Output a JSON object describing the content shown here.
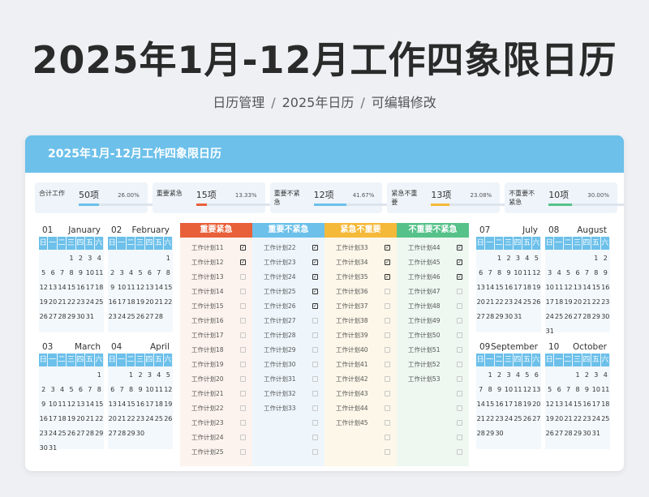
{
  "title": "2025年1月-12月工作四象限日历",
  "breadcrumb": [
    "日历管理",
    "2025年日历",
    "可编辑修改"
  ],
  "card_title": "2025年1月-12月工作四象限日历",
  "stats": [
    {
      "label": "合计工作",
      "count": "50项",
      "pct": "26.00%",
      "level": 0.26,
      "color": "#6cc0ea"
    },
    {
      "label": "重要紧急",
      "count": "15项",
      "pct": "13.33%",
      "level": 0.1333,
      "color": "#e8603a"
    },
    {
      "label": "重要不紧急",
      "count": "12项",
      "pct": "41.67%",
      "level": 0.4167,
      "color": "#6cc0ea"
    },
    {
      "label": "紧急不重要",
      "count": "13项",
      "pct": "23.08%",
      "level": 0.2308,
      "color": "#f5b93a"
    },
    {
      "label": "不重要不紧急",
      "count": "10项",
      "pct": "30.00%",
      "level": 0.3,
      "color": "#56c28a"
    }
  ],
  "weekdays": [
    "日",
    "一",
    "二",
    "三",
    "四",
    "五",
    "六"
  ],
  "months": [
    {
      "num": "01",
      "name": "January",
      "days": [
        "",
        "",
        "",
        "1",
        "2",
        "3",
        "4",
        "5",
        "6",
        "7",
        "8",
        "9",
        "10",
        "11",
        "12",
        "13",
        "14",
        "15",
        "16",
        "17",
        "18",
        "19",
        "20",
        "21",
        "22",
        "23",
        "24",
        "25",
        "26",
        "27",
        "28",
        "29",
        "30",
        "31"
      ]
    },
    {
      "num": "02",
      "name": "February",
      "days": [
        "",
        "",
        "",
        "",
        "",
        "",
        "1",
        "2",
        "3",
        "4",
        "5",
        "6",
        "7",
        "8",
        "9",
        "10",
        "11",
        "12",
        "13",
        "14",
        "15",
        "16",
        "17",
        "18",
        "19",
        "20",
        "21",
        "22",
        "23",
        "24",
        "25",
        "26",
        "27",
        "28"
      ]
    },
    {
      "num": "03",
      "name": "March",
      "days": [
        "",
        "",
        "",
        "",
        "",
        "",
        "1",
        "2",
        "3",
        "4",
        "5",
        "6",
        "7",
        "8",
        "9",
        "10",
        "11",
        "12",
        "13",
        "14",
        "15",
        "16",
        "17",
        "18",
        "19",
        "20",
        "21",
        "22",
        "23",
        "24",
        "25",
        "26",
        "27",
        "28",
        "29",
        "30",
        "31"
      ]
    },
    {
      "num": "04",
      "name": "April",
      "days": [
        "",
        "",
        "1",
        "2",
        "3",
        "4",
        "5",
        "6",
        "7",
        "8",
        "9",
        "10",
        "11",
        "12",
        "13",
        "14",
        "15",
        "16",
        "17",
        "18",
        "19",
        "20",
        "21",
        "22",
        "23",
        "24",
        "25",
        "26",
        "27",
        "28",
        "29",
        "30"
      ]
    },
    {
      "num": "07",
      "name": "July",
      "days": [
        "",
        "",
        "1",
        "2",
        "3",
        "4",
        "5",
        "6",
        "7",
        "8",
        "9",
        "10",
        "11",
        "12",
        "13",
        "14",
        "15",
        "16",
        "17",
        "18",
        "19",
        "20",
        "21",
        "22",
        "23",
        "24",
        "25",
        "26",
        "27",
        "28",
        "29",
        "30",
        "31"
      ]
    },
    {
      "num": "08",
      "name": "August",
      "days": [
        "",
        "",
        "",
        "",
        "",
        "1",
        "2",
        "3",
        "4",
        "5",
        "6",
        "7",
        "8",
        "9",
        "10",
        "11",
        "12",
        "13",
        "14",
        "15",
        "16",
        "17",
        "18",
        "19",
        "20",
        "21",
        "22",
        "23",
        "24",
        "25",
        "26",
        "27",
        "28",
        "29",
        "30",
        "31"
      ]
    },
    {
      "num": "09",
      "name": "September",
      "days": [
        "",
        "1",
        "2",
        "3",
        "4",
        "5",
        "6",
        "7",
        "8",
        "9",
        "10",
        "11",
        "12",
        "13",
        "14",
        "15",
        "16",
        "17",
        "18",
        "19",
        "20",
        "21",
        "22",
        "23",
        "24",
        "25",
        "26",
        "27",
        "28",
        "29",
        "30"
      ]
    },
    {
      "num": "10",
      "name": "October",
      "days": [
        "",
        "",
        "",
        "1",
        "2",
        "3",
        "4",
        "5",
        "6",
        "7",
        "8",
        "9",
        "10",
        "11",
        "12",
        "13",
        "14",
        "15",
        "16",
        "17",
        "18",
        "19",
        "20",
        "21",
        "22",
        "23",
        "24",
        "25",
        "26",
        "27",
        "28",
        "29",
        "30",
        "31"
      ]
    }
  ],
  "quadrants": [
    {
      "title": "重要紧急",
      "color": "#e8603a",
      "bg": "#fdf3ee",
      "tasks": [
        {
          "name": "工作计划11",
          "done": true
        },
        {
          "name": "工作计划12",
          "done": true
        },
        {
          "name": "工作计划13",
          "done": false
        },
        {
          "name": "工作计划14",
          "done": false
        },
        {
          "name": "工作计划15",
          "done": false
        },
        {
          "name": "工作计划16",
          "done": false
        },
        {
          "name": "工作计划17",
          "done": false
        },
        {
          "name": "工作计划18",
          "done": false
        },
        {
          "name": "工作计划19",
          "done": false
        },
        {
          "name": "工作计划20",
          "done": false
        },
        {
          "name": "工作计划21",
          "done": false
        },
        {
          "name": "工作计划22",
          "done": false
        },
        {
          "name": "工作计划23",
          "done": false
        },
        {
          "name": "工作计划24",
          "done": false
        },
        {
          "name": "工作计划25",
          "done": false
        }
      ]
    },
    {
      "title": "重要不紧急",
      "color": "#6cc0ea",
      "bg": "#eef6fc",
      "tasks": [
        {
          "name": "工作计划22",
          "done": true
        },
        {
          "name": "工作计划23",
          "done": true
        },
        {
          "name": "工作计划24",
          "done": true
        },
        {
          "name": "工作计划25",
          "done": true
        },
        {
          "name": "工作计划26",
          "done": true
        },
        {
          "name": "工作计划27",
          "done": false
        },
        {
          "name": "工作计划28",
          "done": false
        },
        {
          "name": "工作计划29",
          "done": false
        },
        {
          "name": "工作计划30",
          "done": false
        },
        {
          "name": "工作计划31",
          "done": false
        },
        {
          "name": "工作计划32",
          "done": false
        },
        {
          "name": "工作计划33",
          "done": false
        },
        {
          "name": "",
          "done": false
        },
        {
          "name": "",
          "done": false
        },
        {
          "name": "",
          "done": false
        }
      ]
    },
    {
      "title": "紧急不重要",
      "color": "#f5b93a",
      "bg": "#fdf7e9",
      "tasks": [
        {
          "name": "工作计划33",
          "done": true
        },
        {
          "name": "工作计划34",
          "done": true
        },
        {
          "name": "工作计划35",
          "done": true
        },
        {
          "name": "工作计划36",
          "done": false
        },
        {
          "name": "工作计划37",
          "done": false
        },
        {
          "name": "工作计划38",
          "done": false
        },
        {
          "name": "工作计划39",
          "done": false
        },
        {
          "name": "工作计划40",
          "done": false
        },
        {
          "name": "工作计划41",
          "done": false
        },
        {
          "name": "工作计划42",
          "done": false
        },
        {
          "name": "工作计划43",
          "done": false
        },
        {
          "name": "工作计划44",
          "done": false
        },
        {
          "name": "工作计划45",
          "done": false
        },
        {
          "name": "",
          "done": false
        },
        {
          "name": "",
          "done": false
        }
      ]
    },
    {
      "title": "不重要不紧急",
      "color": "#56c28a",
      "bg": "#eef8f1",
      "tasks": [
        {
          "name": "工作计划44",
          "done": true
        },
        {
          "name": "工作计划45",
          "done": true
        },
        {
          "name": "工作计划46",
          "done": true
        },
        {
          "name": "工作计划47",
          "done": false
        },
        {
          "name": "工作计划48",
          "done": false
        },
        {
          "name": "工作计划49",
          "done": false
        },
        {
          "name": "工作计划50",
          "done": false
        },
        {
          "name": "工作计划51",
          "done": false
        },
        {
          "name": "工作计划52",
          "done": false
        },
        {
          "name": "工作计划53",
          "done": false
        },
        {
          "name": "",
          "done": false
        },
        {
          "name": "",
          "done": false
        },
        {
          "name": "",
          "done": false
        },
        {
          "name": "",
          "done": false
        },
        {
          "name": "",
          "done": false
        }
      ]
    }
  ]
}
